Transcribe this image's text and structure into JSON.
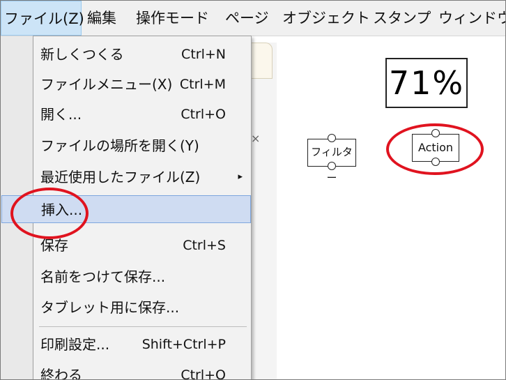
{
  "menubar": {
    "items": [
      {
        "label": "ファイル(Z)"
      },
      {
        "label": "編集"
      },
      {
        "label": "操作モード"
      },
      {
        "label": "ページ"
      },
      {
        "label": "オブジェクト"
      },
      {
        "label": "スタンプ"
      },
      {
        "label": "ウィンドウ"
      }
    ]
  },
  "file_menu": {
    "items": [
      {
        "label": "新しくつくる",
        "shortcut": "Ctrl+N"
      },
      {
        "label": "ファイルメニュー(X)",
        "shortcut": "Ctrl+M"
      },
      {
        "label": "開く...",
        "shortcut": "Ctrl+O"
      },
      {
        "label": "ファイルの場所を開く(Y)",
        "shortcut": ""
      },
      {
        "label": "最近使用したファイル(Z)",
        "shortcut": "",
        "submenu_arrow": "▸"
      },
      {
        "label": "挿入...",
        "shortcut": "",
        "highlighted": true
      },
      {
        "label": "保存",
        "shortcut": "Ctrl+S"
      },
      {
        "label": "名前をつけて保存...",
        "shortcut": ""
      },
      {
        "label": "タブレット用に保存...",
        "shortcut": ""
      },
      {
        "label": "印刷設定...",
        "shortcut": "Shift+Ctrl+P"
      },
      {
        "label": "終わる",
        "shortcut": "Ctrl+Q"
      }
    ]
  },
  "side_panel": {
    "close_glyph": "×"
  },
  "canvas": {
    "zoom_label": "71%",
    "filter_node_label": "フィルター",
    "action_node_label": "Action"
  },
  "annotations": {
    "circle_color": "#e0131f"
  }
}
